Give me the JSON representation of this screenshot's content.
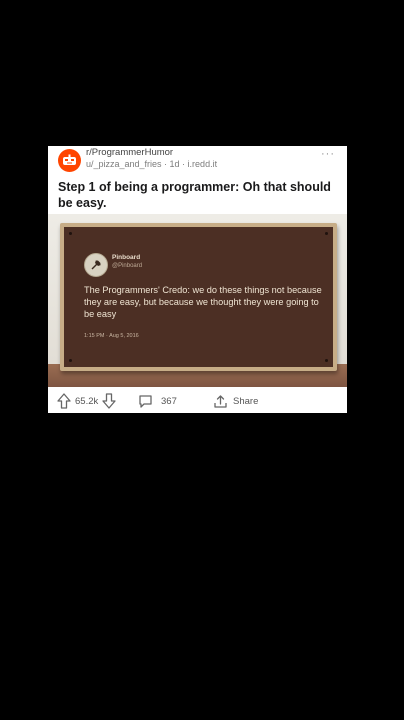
{
  "post": {
    "subreddit": "r/ProgrammerHumor",
    "meta": "u/_pizza_and_fries · 1d · i.redd.it",
    "title": "Step 1 of being a programmer: Oh that should be easy.",
    "more_label": "···"
  },
  "image": {
    "tweet_name": "Pinboard",
    "tweet_handle": "@Pinboard",
    "tweet_text": "The Programmers' Credo: we do these things not because they are easy, but because we thought they were going to be easy",
    "tweet_time": "1:15 PM · Aug 5, 2016"
  },
  "actions": {
    "upvotes": "65.2k",
    "comments": "367",
    "share_label": "Share"
  },
  "colors": {
    "accent": "#ff4500",
    "plaque": "#4c2f24"
  }
}
